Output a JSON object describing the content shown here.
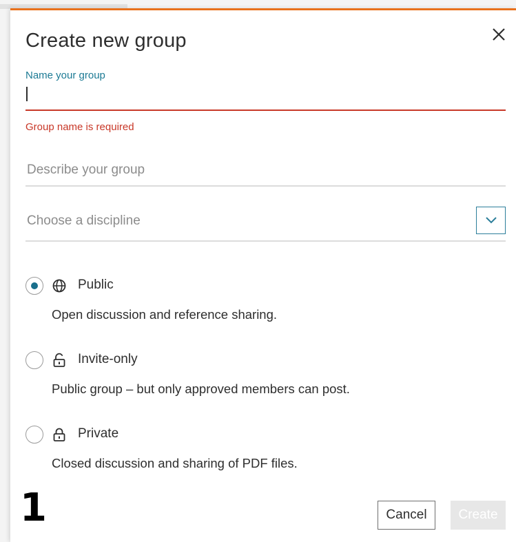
{
  "dialog": {
    "title": "Create new group",
    "close_icon": "close-icon"
  },
  "name_field": {
    "label": "Name your group",
    "value": "",
    "error": "Group name is required"
  },
  "description_field": {
    "placeholder": "Describe your group",
    "value": ""
  },
  "discipline_select": {
    "placeholder": "Choose a discipline",
    "icon": "chevron-down-icon"
  },
  "privacy_options": [
    {
      "label": "Public",
      "description": "Open discussion and reference sharing.",
      "icon": "globe-icon",
      "selected": true
    },
    {
      "label": "Invite-only",
      "description": "Public group – but only approved members can post.",
      "icon": "unlock-icon",
      "selected": false
    },
    {
      "label": "Private",
      "description": "Closed discussion and sharing of PDF files.",
      "icon": "lock-icon",
      "selected": false
    }
  ],
  "step_number": "1",
  "buttons": {
    "cancel": "Cancel",
    "create": "Create"
  },
  "colors": {
    "accent_border": "#e9711c",
    "label_teal": "#1c7a94",
    "error_red": "#c83727",
    "radio_selected": "#1a6f8c",
    "disabled_button": "#e7e7e7"
  }
}
